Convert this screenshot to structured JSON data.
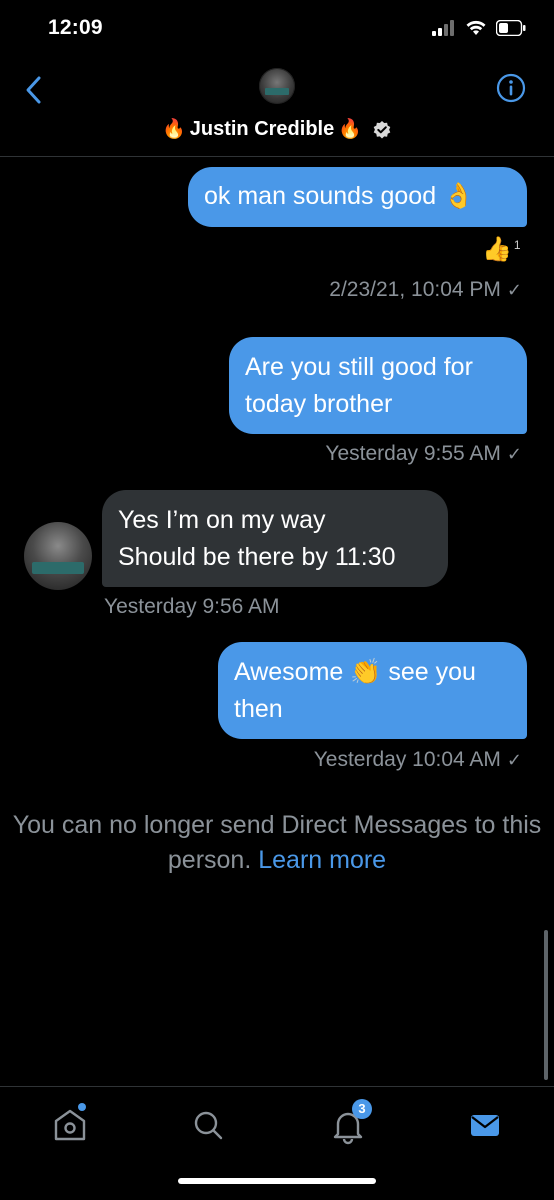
{
  "status_bar": {
    "time": "12:09",
    "icons": [
      "cellular-signal-icon",
      "wifi-icon",
      "battery-icon"
    ]
  },
  "header": {
    "name": "Justin Credible",
    "name_emoji_left": "🔥",
    "name_emoji_right": "🔥",
    "verified": true,
    "icons": [
      "back-chevron-icon",
      "info-icon",
      "avatar"
    ]
  },
  "messages": [
    {
      "direction": "out",
      "lines": [
        "ok man sounds good 👌"
      ],
      "reaction": {
        "emoji": "👍",
        "count": "1"
      },
      "timestamp": "2/23/21, 10:04 PM",
      "check": "✓"
    },
    {
      "direction": "out",
      "lines": [
        "Are you still good for",
        "today brother"
      ],
      "timestamp": "Yesterday 9:55 AM",
      "check": "✓"
    },
    {
      "direction": "in",
      "lines": [
        "Yes I’m on my way",
        "Should be there by 11:30"
      ],
      "timestamp": "Yesterday 9:56 AM"
    },
    {
      "direction": "out",
      "lines": [
        "Awesome 👏 see you",
        "then"
      ],
      "timestamp": "Yesterday 10:04 AM",
      "check": "✓"
    }
  ],
  "notice": {
    "text": "You can no longer send Direct Messages to this person.",
    "link": "Learn more"
  },
  "bottom_nav": {
    "items": [
      "home-icon",
      "search-icon",
      "notifications-icon",
      "messages-icon"
    ],
    "notifications_badge": "3"
  },
  "colors": {
    "accent": "#4a98e8",
    "incoming_bubble": "#2f3336",
    "muted_text": "#8b9299",
    "background": "#000000"
  }
}
